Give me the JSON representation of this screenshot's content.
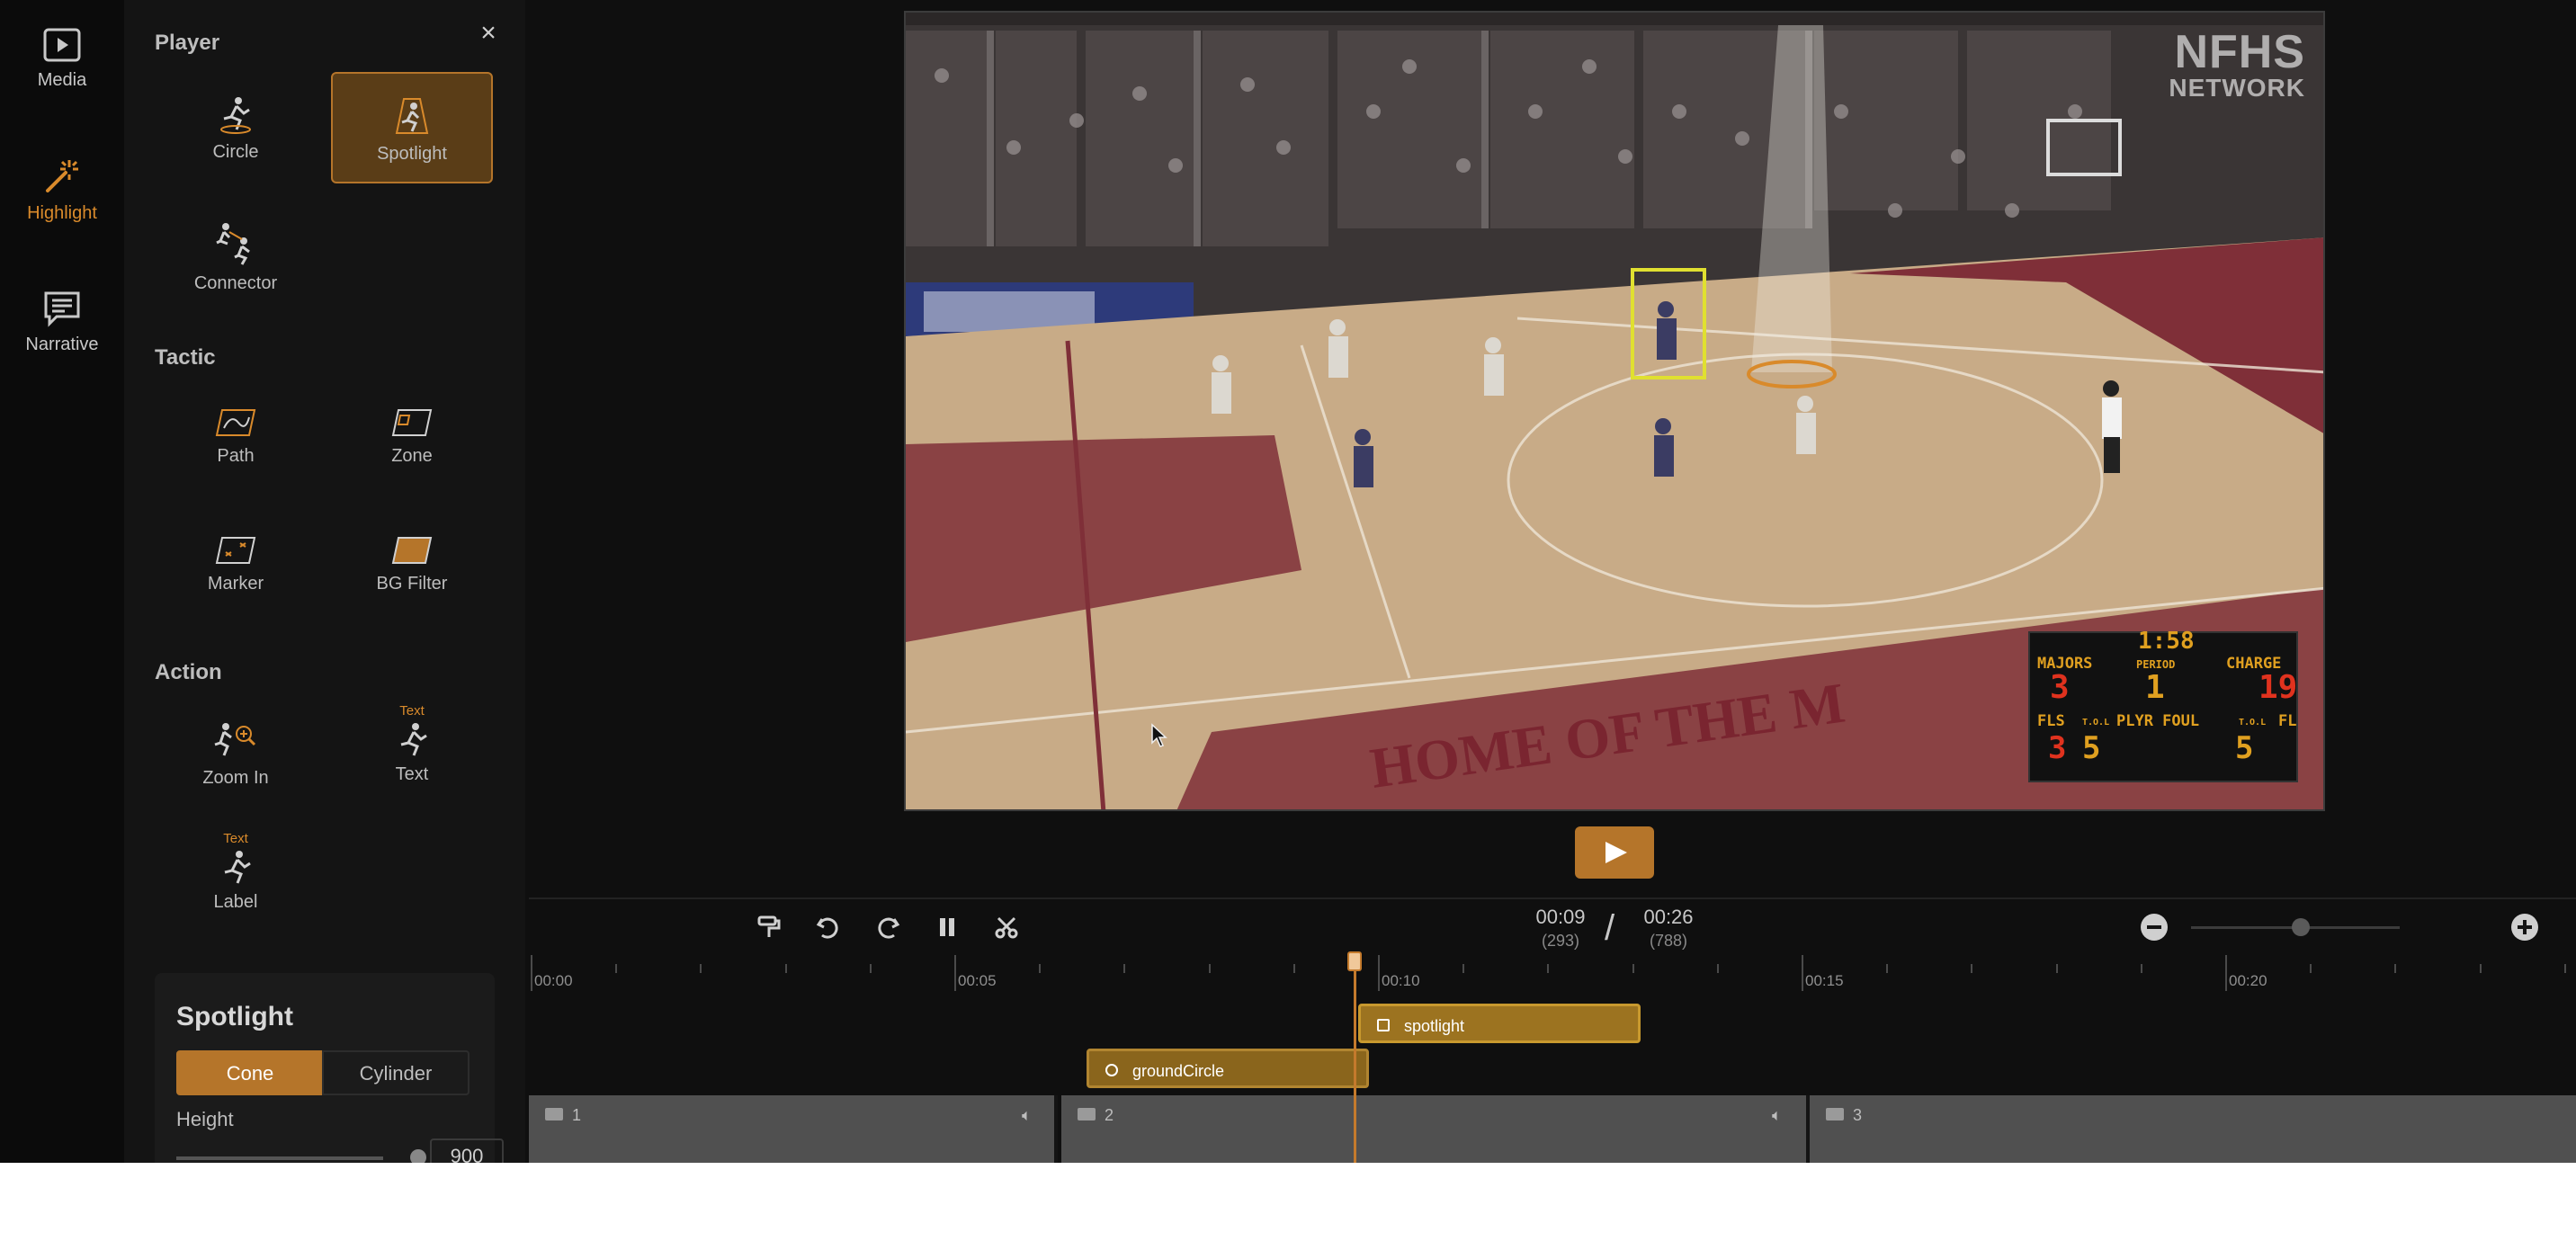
{
  "nav": [
    {
      "label": "Media",
      "icon": "media-icon",
      "active": false
    },
    {
      "label": "Highlight",
      "icon": "magic-wand-icon",
      "active": true
    },
    {
      "label": "Narrative",
      "icon": "narrative-icon",
      "active": false
    }
  ],
  "panel": {
    "close_glyph": "×",
    "player": {
      "title": "Player",
      "tools": [
        "Circle",
        "Spotlight",
        "Connector"
      ],
      "selected": "Spotlight"
    },
    "tactic": {
      "title": "Tactic",
      "tools": [
        "Path",
        "Zone",
        "Marker",
        "BG Filter"
      ]
    },
    "action": {
      "title": "Action",
      "tools": [
        "Zoom In",
        "Text",
        "Label"
      ],
      "tiny_text": "Text"
    }
  },
  "spotlight_settings": {
    "title": "Spotlight",
    "modes": [
      "Cone",
      "Cylinder"
    ],
    "selected_mode": "Cone",
    "height_label": "Height",
    "height_value": "900"
  },
  "video": {
    "watermark_line1": "NFHS",
    "watermark_line2": "NETWORK",
    "floor_text": "HOME OF THE M",
    "scoreboard": {
      "time": "1:58",
      "home_label": "MAJORS",
      "home_score": "3",
      "period_label": "PERIOD",
      "period": "1",
      "away_label": "CHARGE",
      "away_score": "19",
      "fls_label": "FLS",
      "fls": "3",
      "tol_label": "T.O.L",
      "home_tol": "5",
      "plyr_foul_label": "PLYR FOUL",
      "away_tol": "5",
      "away_fls_label": "FL"
    }
  },
  "toolbar": {
    "icons": [
      "paint-format-icon",
      "undo-icon",
      "redo-icon",
      "pause-icon",
      "cut-icon"
    ],
    "current_time": "00:09",
    "current_frame": "(293)",
    "separator": "/",
    "total_time": "00:26",
    "total_frame": "(788)"
  },
  "timeline": {
    "ruler_labels": [
      "00:00",
      "00:05",
      "00:10",
      "00:15",
      "00:20"
    ],
    "clips": [
      {
        "label": "spotlight",
        "type": "spotlight"
      },
      {
        "label": "groundCircle",
        "type": "circle"
      }
    ],
    "tracks": [
      "1",
      "2",
      "3"
    ]
  },
  "colors": {
    "accent": "#b5752a",
    "panel": "#141414",
    "background": "#0f0f0f"
  }
}
